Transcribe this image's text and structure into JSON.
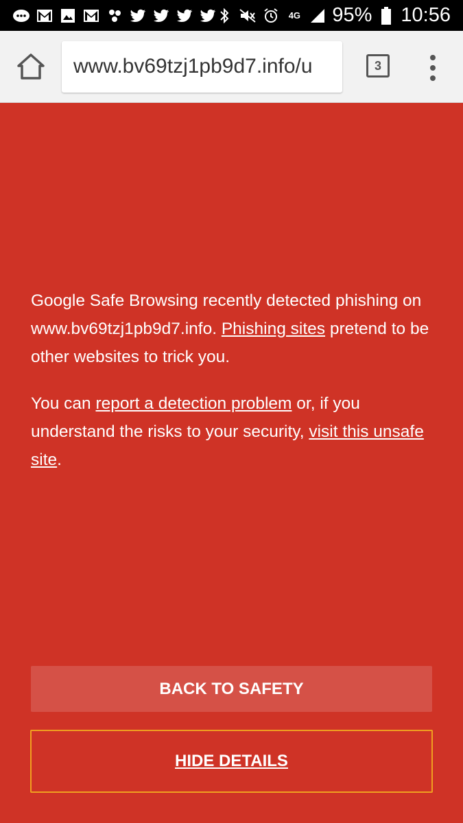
{
  "status_bar": {
    "battery_percent": "95%",
    "time": "10:56",
    "network": "4G",
    "left_icons": [
      "message-icon",
      "gmail-icon",
      "gallery-icon",
      "gmail-icon",
      "pinwheel-icon",
      "twitter-icon",
      "twitter-icon",
      "twitter-icon",
      "twitter-icon"
    ],
    "right_icons": [
      "bluetooth-icon",
      "mute-icon",
      "alarm-icon",
      "network-4g-icon",
      "signal-icon",
      "battery-icon"
    ]
  },
  "toolbar": {
    "url": "www.bv69tzj1pb9d7.info/u",
    "tab_count": "3"
  },
  "warning": {
    "p1_text_a": "Google Safe Browsing recently detected phishing on www.bv69tzj1pb9d7.info. ",
    "p1_link": "Phishing sites",
    "p1_text_b": " pretend to be other websites to trick you.",
    "p2_text_a": "You can ",
    "p2_link_report": "report a detection problem",
    "p2_text_b": " or, if you understand the risks to your security, ",
    "p2_link_visit": "visit this unsafe site",
    "p2_text_c": "."
  },
  "buttons": {
    "back_to_safety": "BACK TO SAFETY",
    "hide_details": "HIDE DETAILS"
  },
  "colors": {
    "background": "#cf3326",
    "primary_button": "#d55147",
    "focus_border": "#f0a020"
  }
}
